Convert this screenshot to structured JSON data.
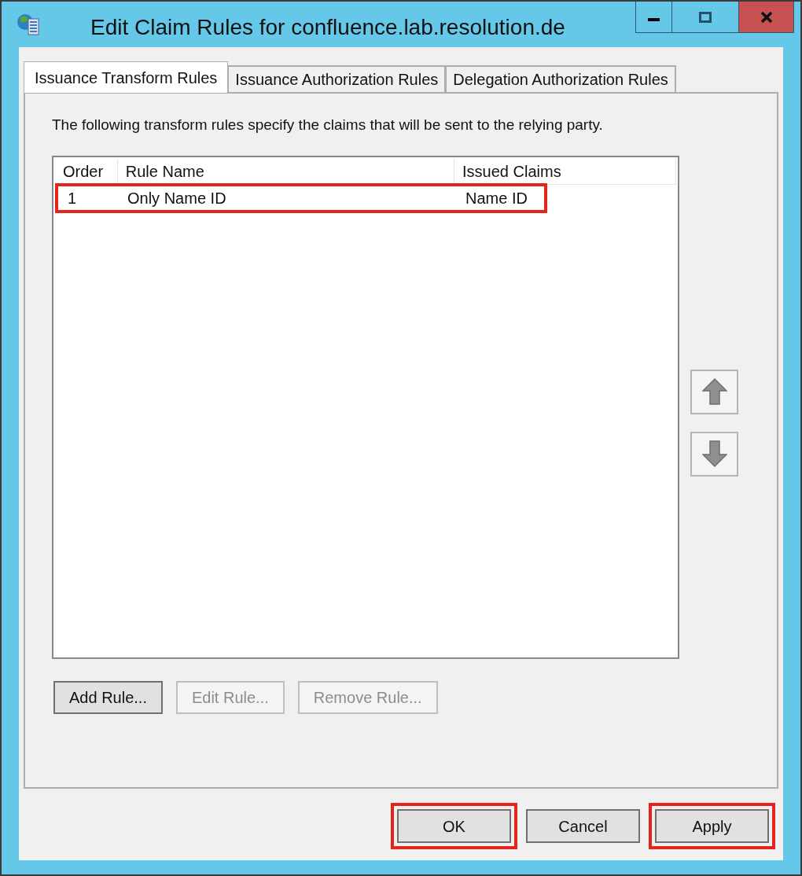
{
  "window": {
    "title": "Edit Claim Rules for confluence.lab.resolution.de"
  },
  "tabs": [
    {
      "label": "Issuance Transform Rules",
      "selected": true
    },
    {
      "label": "Issuance Authorization Rules",
      "selected": false
    },
    {
      "label": "Delegation Authorization Rules",
      "selected": false
    }
  ],
  "description": "The following transform rules specify the claims that will be sent to the relying party.",
  "table": {
    "columns": [
      "Order",
      "Rule Name",
      "Issued Claims"
    ],
    "rows": [
      {
        "cells": [
          "1",
          "Only Name ID",
          "Name ID"
        ],
        "highlighted": true
      }
    ]
  },
  "rule_buttons": [
    {
      "label": "Add Rule...",
      "disabled": false
    },
    {
      "label": "Edit Rule...",
      "disabled": true
    },
    {
      "label": "Remove Rule...",
      "disabled": true
    }
  ],
  "dialog_buttons": [
    {
      "label": "OK",
      "highlighted": true
    },
    {
      "label": "Cancel",
      "highlighted": false
    },
    {
      "label": "Apply",
      "highlighted": true
    }
  ]
}
